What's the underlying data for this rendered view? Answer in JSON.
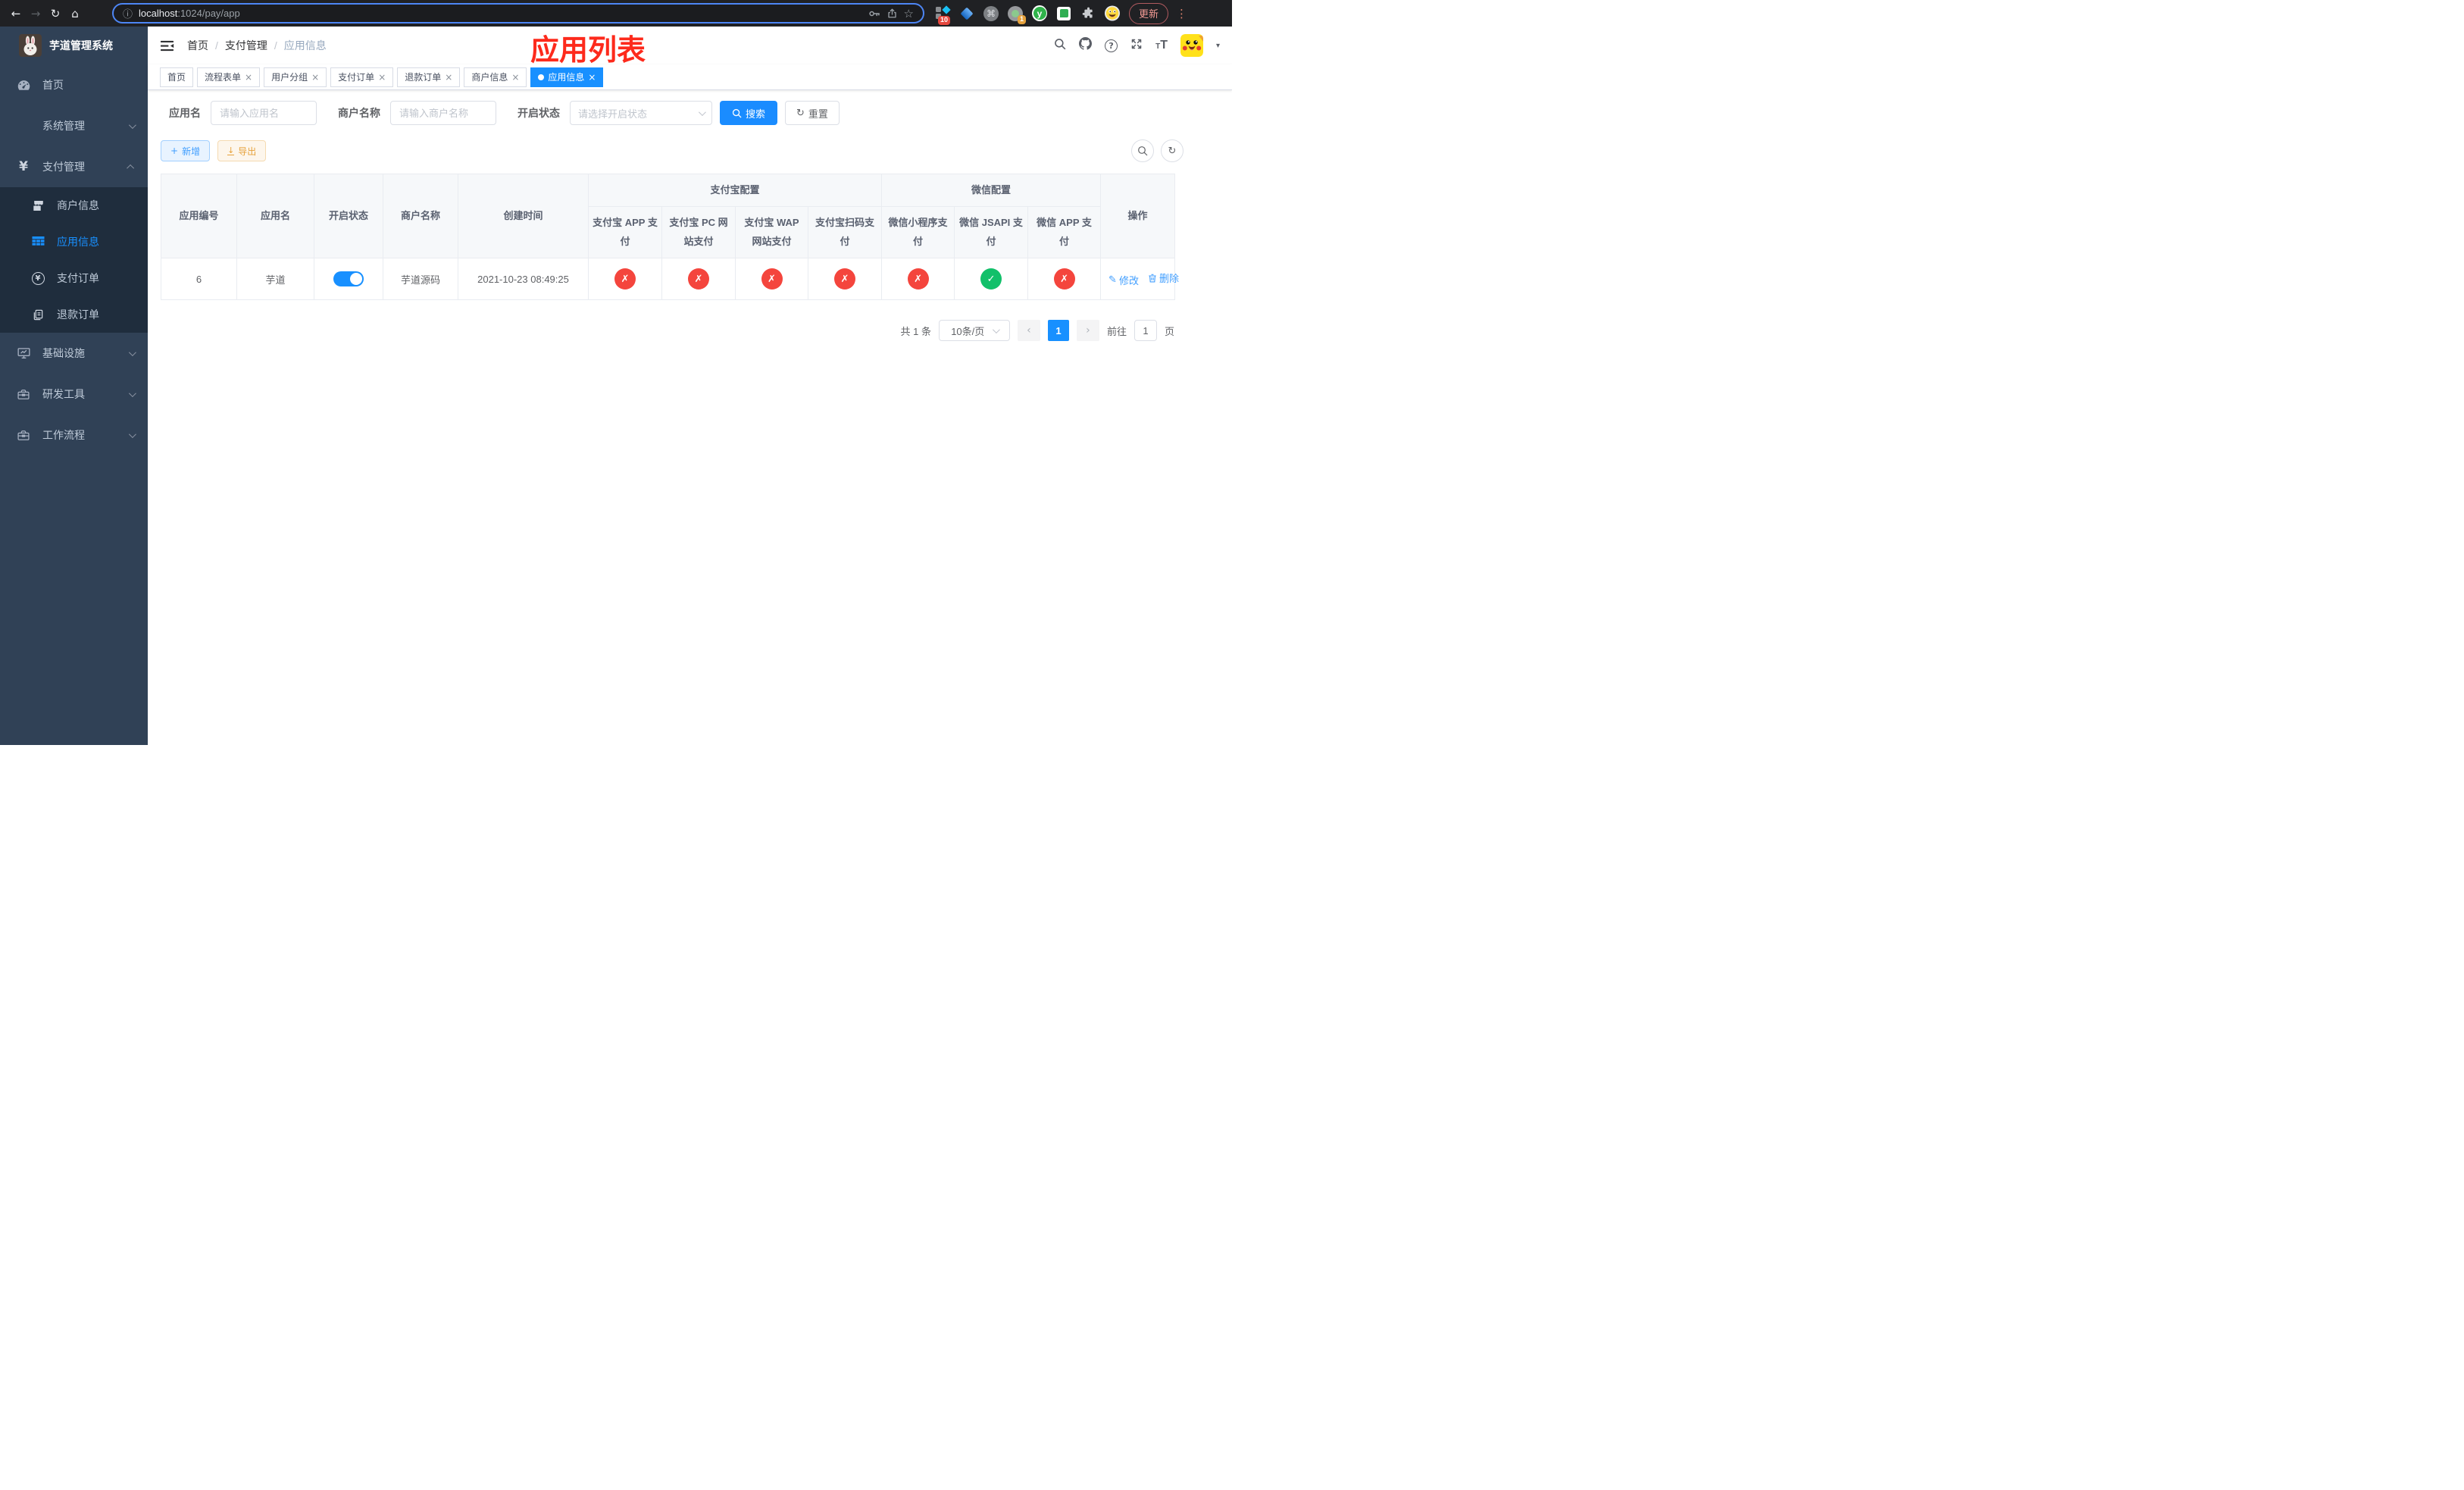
{
  "browser": {
    "url_host": "localhost",
    "url_rest": ":1024/pay/app",
    "ext_badge_blocker": "10",
    "ext_badge_recorder": "1",
    "ext_y_letter": "y",
    "update_label": "更新"
  },
  "annotation": {
    "title": "应用列表",
    "color": "#fd2a1c"
  },
  "sidebar": {
    "logo_title": "芋道管理系统",
    "menu_home": "首页",
    "menu_system": "系统管理",
    "menu_pay": "支付管理",
    "sub_merchant": "商户信息",
    "sub_app": "应用信息",
    "sub_pay_order": "支付订单",
    "sub_refund_order": "退款订单",
    "menu_infra": "基础设施",
    "menu_dev": "研发工具",
    "menu_workflow": "工作流程"
  },
  "breadcrumb": {
    "items": [
      "首页",
      "支付管理",
      "应用信息"
    ],
    "separator": "/"
  },
  "tabs": {
    "items": [
      {
        "label": "首页"
      },
      {
        "label": "流程表单"
      },
      {
        "label": "用户分组"
      },
      {
        "label": "支付订单"
      },
      {
        "label": "退款订单"
      },
      {
        "label": "商户信息"
      },
      {
        "label": "应用信息"
      }
    ]
  },
  "filters": {
    "app_name_label": "应用名",
    "app_name_placeholder": "请输入应用名",
    "merchant_label": "商户名称",
    "merchant_placeholder": "请输入商户名称",
    "status_label": "开启状态",
    "status_placeholder": "请选择开启状态",
    "search_label": "搜索",
    "reset_label": "重置"
  },
  "toolbar": {
    "add_label": "新增",
    "export_label": "导出"
  },
  "table": {
    "columns": [
      "应用编号",
      "应用名",
      "开启状态",
      "商户名称",
      "创建时间"
    ],
    "groups": [
      {
        "label": "支付宝配置",
        "children": [
          "支付宝 APP 支付",
          "支付宝 PC 网站支付",
          "支付宝 WAP 网站支付",
          "支付宝扫码支付"
        ]
      },
      {
        "label": "微信配置",
        "children": [
          "微信小程序支付",
          "微信 JSAPI 支付",
          "微信 APP 支付"
        ]
      }
    ],
    "actions_label": "操作",
    "row": {
      "id": "6",
      "name": "芋道",
      "enabled": true,
      "merchant": "芋道源码",
      "created_at": "2021-10-23 08:49:25",
      "statuses": [
        false,
        false,
        false,
        false,
        false,
        true,
        false
      ],
      "edit_label": "修改",
      "delete_label": "删除"
    }
  },
  "pagination": {
    "total_text": "共 1 条",
    "page_size": "10条/页",
    "current_page": "1",
    "goto_label": "前往",
    "goto_value": "1",
    "page_label": "页"
  },
  "icons": {
    "back": "←",
    "forward": "→",
    "reload": "↻",
    "home": "⌂",
    "info": "ⓘ",
    "star": "☆",
    "cmd": "⌘",
    "dots": "⋮",
    "close": "×",
    "plus": "+",
    "download": "↓",
    "refresh": "↻",
    "check": "✓",
    "cross": "✗",
    "prev": "‹",
    "next": "›",
    "caret": "▾",
    "edit": "✎",
    "help": "?",
    "yen": "¥",
    "font_small": "T",
    "font_big": "T"
  }
}
